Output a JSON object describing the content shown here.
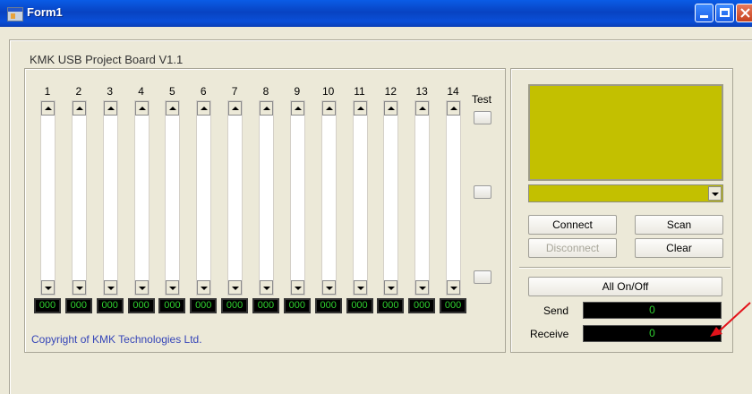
{
  "window": {
    "title": "Form1"
  },
  "board": {
    "title": "KMK USB Project Board V1.1",
    "copyright": "Copyright of KMK Technologies Ltd.",
    "channels": [
      {
        "label": "1",
        "value": "000"
      },
      {
        "label": "2",
        "value": "000"
      },
      {
        "label": "3",
        "value": "000"
      },
      {
        "label": "4",
        "value": "000"
      },
      {
        "label": "5",
        "value": "000"
      },
      {
        "label": "6",
        "value": "000"
      },
      {
        "label": "7",
        "value": "000"
      },
      {
        "label": "8",
        "value": "000"
      },
      {
        "label": "9",
        "value": "000"
      },
      {
        "label": "10",
        "value": "000"
      },
      {
        "label": "11",
        "value": "000"
      },
      {
        "label": "12",
        "value": "000"
      },
      {
        "label": "13",
        "value": "000"
      },
      {
        "label": "14",
        "value": "000"
      }
    ],
    "test_label": "Test"
  },
  "controls": {
    "connect": "Connect",
    "scan": "Scan",
    "disconnect": "Disconnect",
    "clear": "Clear",
    "all_on_off": "All On/Off",
    "send_label": "Send",
    "send_value": "0",
    "receive_label": "Receive",
    "receive_value": "0",
    "lcd_color": "#c3c000"
  },
  "colors": {
    "titlebar": "#0a4fd8",
    "annotation_arrow": "#e3121a",
    "readout_text": "#2fd02f"
  }
}
